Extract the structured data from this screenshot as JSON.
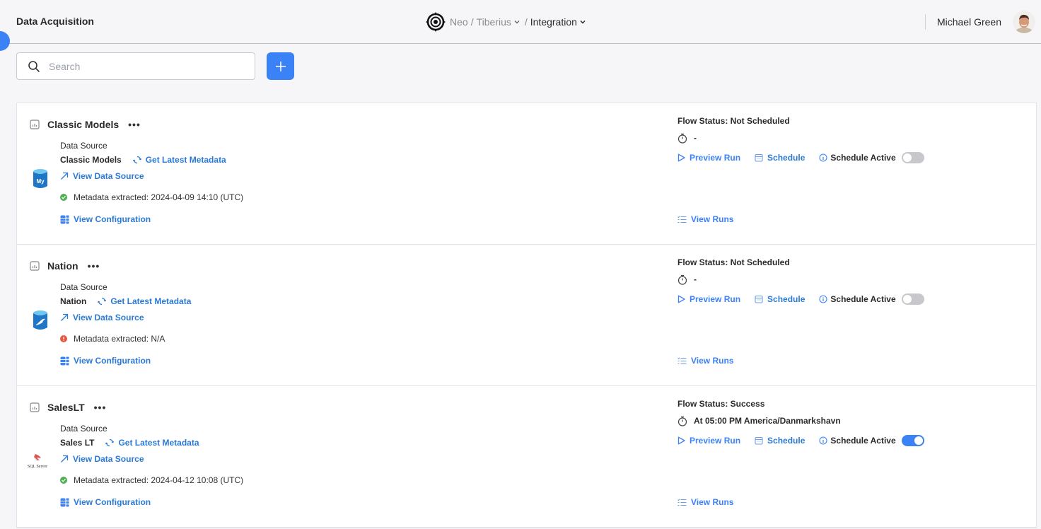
{
  "header": {
    "app_title": "Data Acquisition",
    "breadcrumb": {
      "org": "Neo",
      "separator": "/",
      "project": "Tiberius",
      "section": "Integration"
    },
    "user_name": "Michael Green"
  },
  "toolbar": {
    "search_placeholder": "Search",
    "search_value": "",
    "add_button_label": "+"
  },
  "colors": {
    "accent": "#3b82f6",
    "link": "#2a7ad6",
    "success": "#4caf50",
    "error": "#e8573e"
  },
  "flows": [
    {
      "title": "Classic Models",
      "more": "•••",
      "data_source_label": "Data Source",
      "data_source_name": "Classic Models",
      "source_type_icon": "mysql-icon",
      "get_metadata_label": "Get Latest Metadata",
      "view_source_label": "View Data Source",
      "metadata_status": "success",
      "metadata_text": "Metadata extracted: 2024-04-09 14:10 (UTC)",
      "view_config_label": "View Configuration",
      "flow_status": "Flow Status: Not Scheduled",
      "schedule_text": "-",
      "preview_run_label": "Preview Run",
      "schedule_label": "Schedule",
      "schedule_active_label": "Schedule Active",
      "schedule_active": false,
      "view_runs_label": "View Runs"
    },
    {
      "title": "Nation",
      "more": "•••",
      "data_source_label": "Data Source",
      "data_source_name": "Nation",
      "source_type_icon": "mariadb-icon",
      "get_metadata_label": "Get Latest Metadata",
      "view_source_label": "View Data Source",
      "metadata_status": "error",
      "metadata_text": "Metadata extracted: N/A",
      "view_config_label": "View Configuration",
      "flow_status": "Flow Status: Not Scheduled",
      "schedule_text": "-",
      "preview_run_label": "Preview Run",
      "schedule_label": "Schedule",
      "schedule_active_label": "Schedule Active",
      "schedule_active": false,
      "view_runs_label": "View Runs"
    },
    {
      "title": "SalesLT",
      "more": "•••",
      "data_source_label": "Data Source",
      "data_source_name": "Sales LT",
      "source_type_icon": "sql-server-icon",
      "source_type_caption": "SQL Server",
      "get_metadata_label": "Get Latest Metadata",
      "view_source_label": "View Data Source",
      "metadata_status": "success",
      "metadata_text": "Metadata extracted: 2024-04-12 10:08 (UTC)",
      "view_config_label": "View Configuration",
      "flow_status": "Flow Status: Success",
      "schedule_text": "At 05:00 PM America/Danmarkshavn",
      "preview_run_label": "Preview Run",
      "schedule_label": "Schedule",
      "schedule_active_label": "Schedule Active",
      "schedule_active": true,
      "view_runs_label": "View Runs"
    }
  ]
}
